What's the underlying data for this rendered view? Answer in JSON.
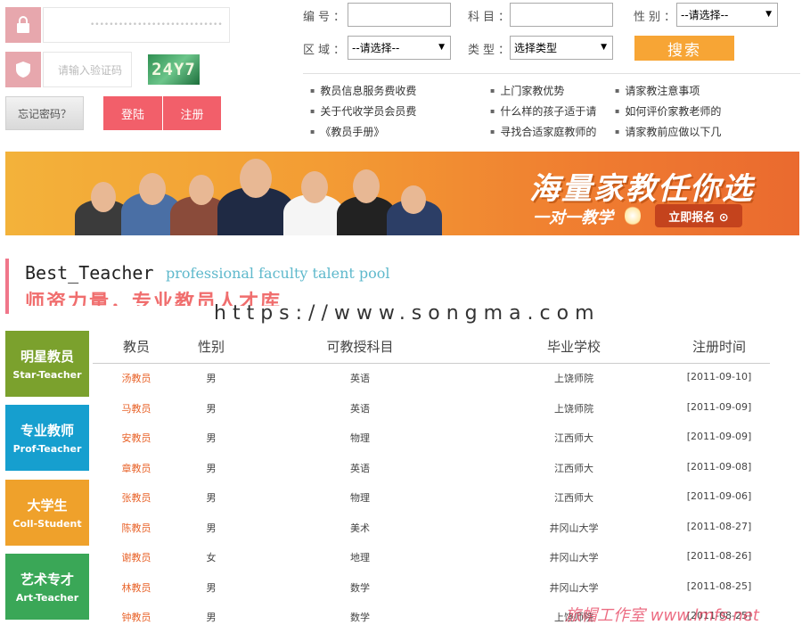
{
  "login": {
    "password_mask": "••••••••••••••••••••••••••••",
    "captcha_placeholder": "请输入验证码",
    "captcha_text": "24Y7",
    "forgot_label": "忘记密码？",
    "login_label": "登陆",
    "register_label": "注册"
  },
  "search": {
    "id_label": "编号：",
    "subject_label": "科目：",
    "gender_label": "性别：",
    "gender_value": "--请选择--",
    "region_label": "区域：",
    "region_value": "--请选择--",
    "type_label": "类型：",
    "type_value": "选择类型",
    "search_label": "搜索"
  },
  "links": {
    "col1": [
      "教员信息服务费收费",
      "关于代收学员会员费",
      "《教员手册》"
    ],
    "col2": [
      "上门家教优势",
      "什么样的孩子适于请",
      "寻找合适家庭教师的"
    ],
    "col3": [
      "请家教注意事项",
      "如何评价家教老师的",
      "请家教前应做以下几"
    ]
  },
  "banner": {
    "title": "海量家教任你选",
    "subtitle": "一对一教学",
    "cta": "立即报名 ⊙"
  },
  "section": {
    "title_en": "Best_Teacher",
    "subtitle_en": "professional faculty talent pool",
    "title_cn": "师资力量，专业教员人才库",
    "watermark": "https://www.songma.com"
  },
  "categories": [
    {
      "cn": "明星教员",
      "en": "Star-Teacher",
      "color": "#7ba12d"
    },
    {
      "cn": "专业教师",
      "en": "Prof-Teacher",
      "color": "#169fcf"
    },
    {
      "cn": "大学生",
      "en": "Coll-Student",
      "color": "#efa12b"
    },
    {
      "cn": "艺术专才",
      "en": "Art-Teacher",
      "color": "#3aa757"
    }
  ],
  "table": {
    "headers": [
      "教员",
      "性别",
      "可教授科目",
      "毕业学校",
      "注册时间"
    ],
    "rows": [
      [
        "汤教员",
        "男",
        "英语",
        "上饶师院",
        "[2011-09-10]"
      ],
      [
        "马教员",
        "男",
        "英语",
        "上饶师院",
        "[2011-09-09]"
      ],
      [
        "安教员",
        "男",
        "物理",
        "江西师大",
        "[2011-09-09]"
      ],
      [
        "章教员",
        "男",
        "英语",
        "江西师大",
        "[2011-09-08]"
      ],
      [
        "张教员",
        "男",
        "物理",
        "江西师大",
        "[2011-09-06]"
      ],
      [
        "陈教员",
        "男",
        "美术",
        "井冈山大学",
        "[2011-08-27]"
      ],
      [
        "谢教员",
        "女",
        "地理",
        "井冈山大学",
        "[2011-08-26]"
      ],
      [
        "林教员",
        "男",
        "数学",
        "井冈山大学",
        "[2011-08-25]"
      ],
      [
        "钟教员",
        "男",
        "数学",
        "上饶师院",
        "[2011-08-25]"
      ]
    ]
  },
  "footer_watermark": "旅帽工作室 www.lmfs.net"
}
